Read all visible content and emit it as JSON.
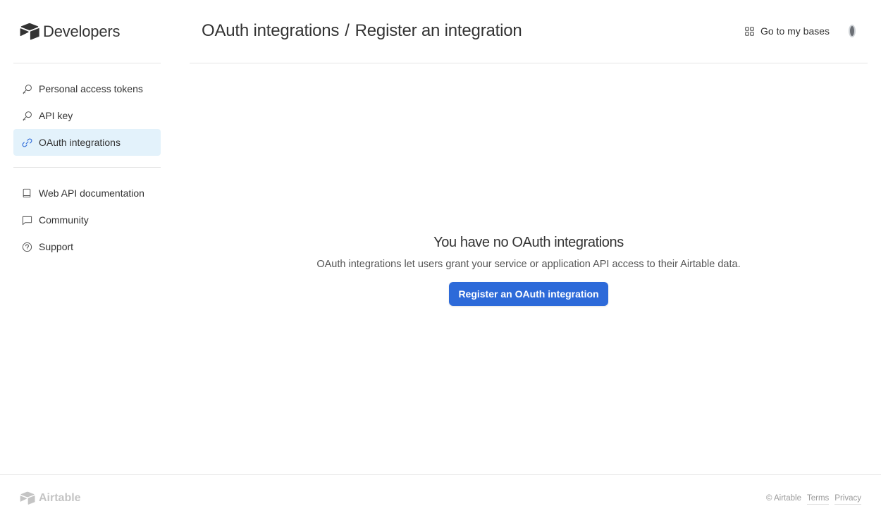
{
  "sidebar": {
    "brand": "Developers",
    "group1": [
      {
        "label": "Personal access tokens",
        "icon": "key-icon",
        "active": false
      },
      {
        "label": "API key",
        "icon": "key-icon",
        "active": false
      },
      {
        "label": "OAuth integrations",
        "icon": "link-icon",
        "active": true
      }
    ],
    "group2": [
      {
        "label": "Web API documentation",
        "icon": "book-icon"
      },
      {
        "label": "Community",
        "icon": "chat-bubble-icon"
      },
      {
        "label": "Support",
        "icon": "help-circle-icon"
      }
    ]
  },
  "header": {
    "breadcrumb_parent": "OAuth integrations",
    "separator": "/",
    "breadcrumb_current": "Register an integration",
    "go_to_bases": "Go to my bases"
  },
  "main": {
    "empty_title": "You have no OAuth integrations",
    "empty_description": "OAuth integrations let users grant your service or application API access to their Airtable data.",
    "register_button": "Register an OAuth integration"
  },
  "footer": {
    "logo_text": "Airtable",
    "copyright": "© Airtable",
    "terms": "Terms",
    "privacy": "Privacy"
  },
  "colors": {
    "accent": "#2d6ad9",
    "active_nav_bg": "#e3f2fb",
    "active_icon": "#2d6ad9"
  }
}
